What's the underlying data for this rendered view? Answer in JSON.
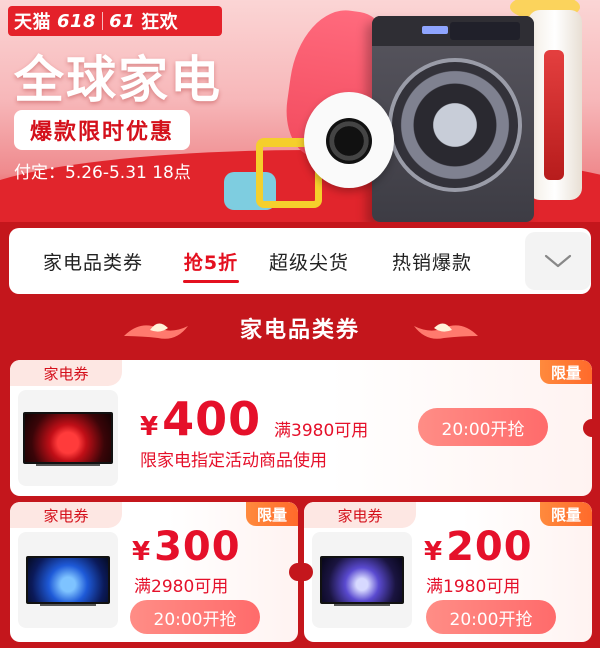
{
  "brand": {
    "tmall": "天猫",
    "num618": "618",
    "num61": "61",
    "carnival": "狂欢"
  },
  "hero": {
    "title": "全球家电",
    "subtitle": "爆款限时优惠",
    "deposit": "付定：5.26-5.31 18点"
  },
  "tabs": [
    {
      "label": "家电品类券",
      "active": false
    },
    {
      "label": "抢5折",
      "active": true
    },
    {
      "label": "超级尖货",
      "active": false
    },
    {
      "label": "热销爆款",
      "active": false
    }
  ],
  "section": {
    "title": "家电品类券"
  },
  "coupons": [
    {
      "tag": "家电券",
      "limit": "限量",
      "currency": "¥",
      "amount": "400",
      "condition": "满3980可用",
      "note": "限家电指定活动商品使用",
      "button": "20:00开抢"
    },
    {
      "tag": "家电券",
      "limit": "限量",
      "currency": "¥",
      "amount": "300",
      "condition": "满2980可用",
      "button": "20:00开抢"
    },
    {
      "tag": "家电券",
      "limit": "限量",
      "currency": "¥",
      "amount": "200",
      "condition": "满1980可用",
      "button": "20:00开抢"
    }
  ],
  "colors": {
    "primary_red": "#e4101f",
    "page_bg": "#c4161c",
    "limit_orange": "#ff6a2b",
    "button_coral": "#ff7b76"
  }
}
